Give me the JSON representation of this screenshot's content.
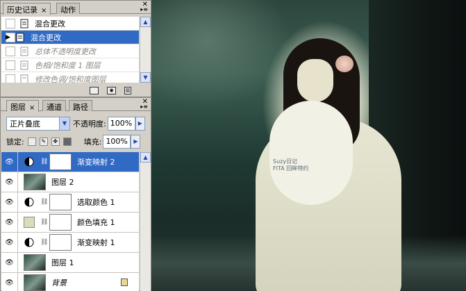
{
  "history_panel": {
    "tabs": [
      {
        "label": "历史记录",
        "active": true
      },
      {
        "label": "动作",
        "active": false
      }
    ],
    "close_glyph": "×",
    "items": [
      {
        "label": "混合更改",
        "state": "normal"
      },
      {
        "label": "混合更改",
        "state": "selected"
      },
      {
        "label": "总体不透明度更改",
        "state": "dimmed"
      },
      {
        "label": "色相/饱和度 1 图层",
        "state": "dimmed"
      },
      {
        "label": "修改色调/饱和度图层",
        "state": "dimmed"
      }
    ],
    "footer_icons": [
      "new-document-icon",
      "camera-icon",
      "trash-icon"
    ]
  },
  "layers_panel": {
    "tabs": [
      {
        "label": "图层",
        "active": true
      },
      {
        "label": "通道",
        "active": false
      },
      {
        "label": "路径",
        "active": false
      }
    ],
    "close_glyph": "×",
    "blend_mode": "正片叠底",
    "opacity_label": "不透明度:",
    "opacity_value": "100%",
    "lock_label": "锁定:",
    "fill_label": "填充:",
    "fill_value": "100%",
    "layers": [
      {
        "name": "渐变映射 2",
        "kind": "adjustment",
        "selected": true
      },
      {
        "name": "图层 2",
        "kind": "image",
        "selected": false
      },
      {
        "name": "选取颜色 1",
        "kind": "adjustment",
        "selected": false
      },
      {
        "name": "颜色填充 1",
        "kind": "fill",
        "selected": false
      },
      {
        "name": "渐变映射 1",
        "kind": "adjustment",
        "selected": false
      },
      {
        "name": "图层 1",
        "kind": "image",
        "selected": false
      },
      {
        "name": "背景",
        "kind": "background",
        "selected": false
      }
    ]
  },
  "canvas": {
    "watermark_lines": [
      "Suzy日记",
      "FITA 回眸特约"
    ]
  },
  "colors": {
    "selection": "#316ac5",
    "panel_bg": "#d4d0c8"
  }
}
